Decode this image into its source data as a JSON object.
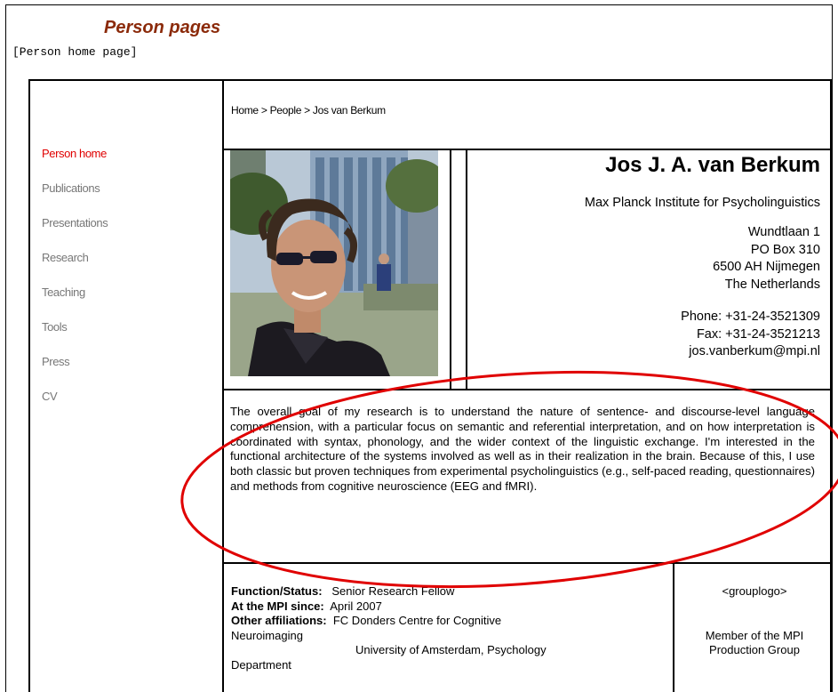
{
  "header": {
    "title": "Person pages",
    "subtitle": "[Person home page]"
  },
  "sidebar": {
    "items": [
      {
        "label": "Person home"
      },
      {
        "label": "Publications"
      },
      {
        "label": "Presentations"
      },
      {
        "label": "Research"
      },
      {
        "label": "Teaching"
      },
      {
        "label": "Tools"
      },
      {
        "label": "Press"
      },
      {
        "label": "CV"
      }
    ]
  },
  "breadcrumb": "Home > People > Jos van Berkum",
  "person": {
    "name": "Jos J. A. van Berkum",
    "institute": "Max Planck Institute for Psycholinguistics",
    "address": [
      "Wundtlaan 1",
      "PO Box 310",
      "6500 AH Nijmegen",
      "The Netherlands"
    ],
    "phone": "Phone: +31-24-3521309",
    "fax": "Fax: +31-24-3521213",
    "email": "jos.vanberkum@mpi.nl"
  },
  "summary": "The overall goal of my research is to understand the nature of sentence- and discourse-level language comprehension, with a particular focus on semantic and referential interpretation, and on how interpretation is coordinated with syntax, phonology, and the wider context of the linguistic exchange. I'm interested in the functional architecture of the systems involved as well as in their realization in the brain. Because of this, I use both classic but proven techniques from experimental psycholinguistics (e.g., self-paced reading, questionnaires) and methods from cognitive neuroscience (EEG and fMRI).",
  "status": {
    "function_label": "Function/Status:",
    "function_value": "Senior Research Fellow",
    "since_label": "At the MPI since:",
    "since_value": "April 2007",
    "affil_label": "Other affiliations:",
    "affil_value_1": "FC Donders Centre for Cognitive",
    "affil_value_1b": "Neuroimaging",
    "affil_value_2": "University of Amsterdam, Psychology",
    "affil_value_2b": "Department"
  },
  "group": {
    "logo_placeholder": "<grouplogo>",
    "member_text_1": "Member of the MPI",
    "member_text_2": "Production Group"
  },
  "colors": {
    "title": "#8b2a0a",
    "active_nav": "#e00000",
    "inactive_nav": "#777777",
    "annotation": "#e00000"
  }
}
